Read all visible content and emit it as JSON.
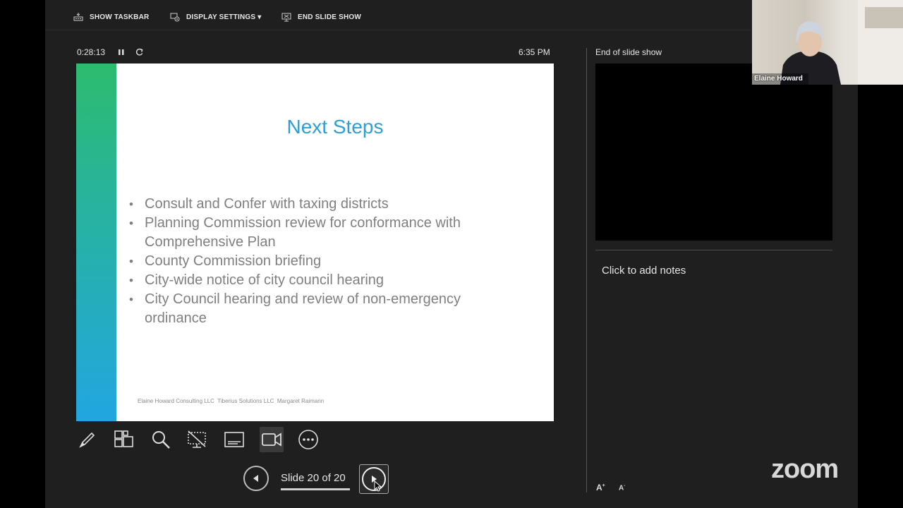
{
  "toolbar": {
    "show_taskbar": "SHOW TASKBAR",
    "display_settings": "DISPLAY SETTINGS ▾",
    "end_slide_show": "END SLIDE SHOW"
  },
  "status": {
    "timer": "0:28:13",
    "clock": "6:35 PM"
  },
  "slide": {
    "title": "Next Steps",
    "bullets": [
      "Consult and Confer with taxing districts",
      "Planning Commission review for conformance with Comprehensive Plan",
      "County Commission briefing",
      "City-wide notice of city council hearing",
      "City Council hearing and review of non-emergency ordinance"
    ],
    "footer": "Elaine Howard Consulting LLC  Tiberius Solutions LLC  Margaret Raimann",
    "accent_color": "#2e9fd6"
  },
  "navigation": {
    "slide_counter": "Slide 20 of 20"
  },
  "next_pane": {
    "label": "End of slide show"
  },
  "notes": {
    "placeholder": "Click to add notes"
  },
  "webcam": {
    "participant_name": "Elaine Howard"
  },
  "branding": {
    "logo_text": "zoom"
  },
  "tools": [
    "pen-tool-icon",
    "see-all-slides-icon",
    "zoom-into-slide-icon",
    "black-or-unblack-slide-icon",
    "subtitles-icon",
    "camera-icon",
    "more-options-icon"
  ]
}
